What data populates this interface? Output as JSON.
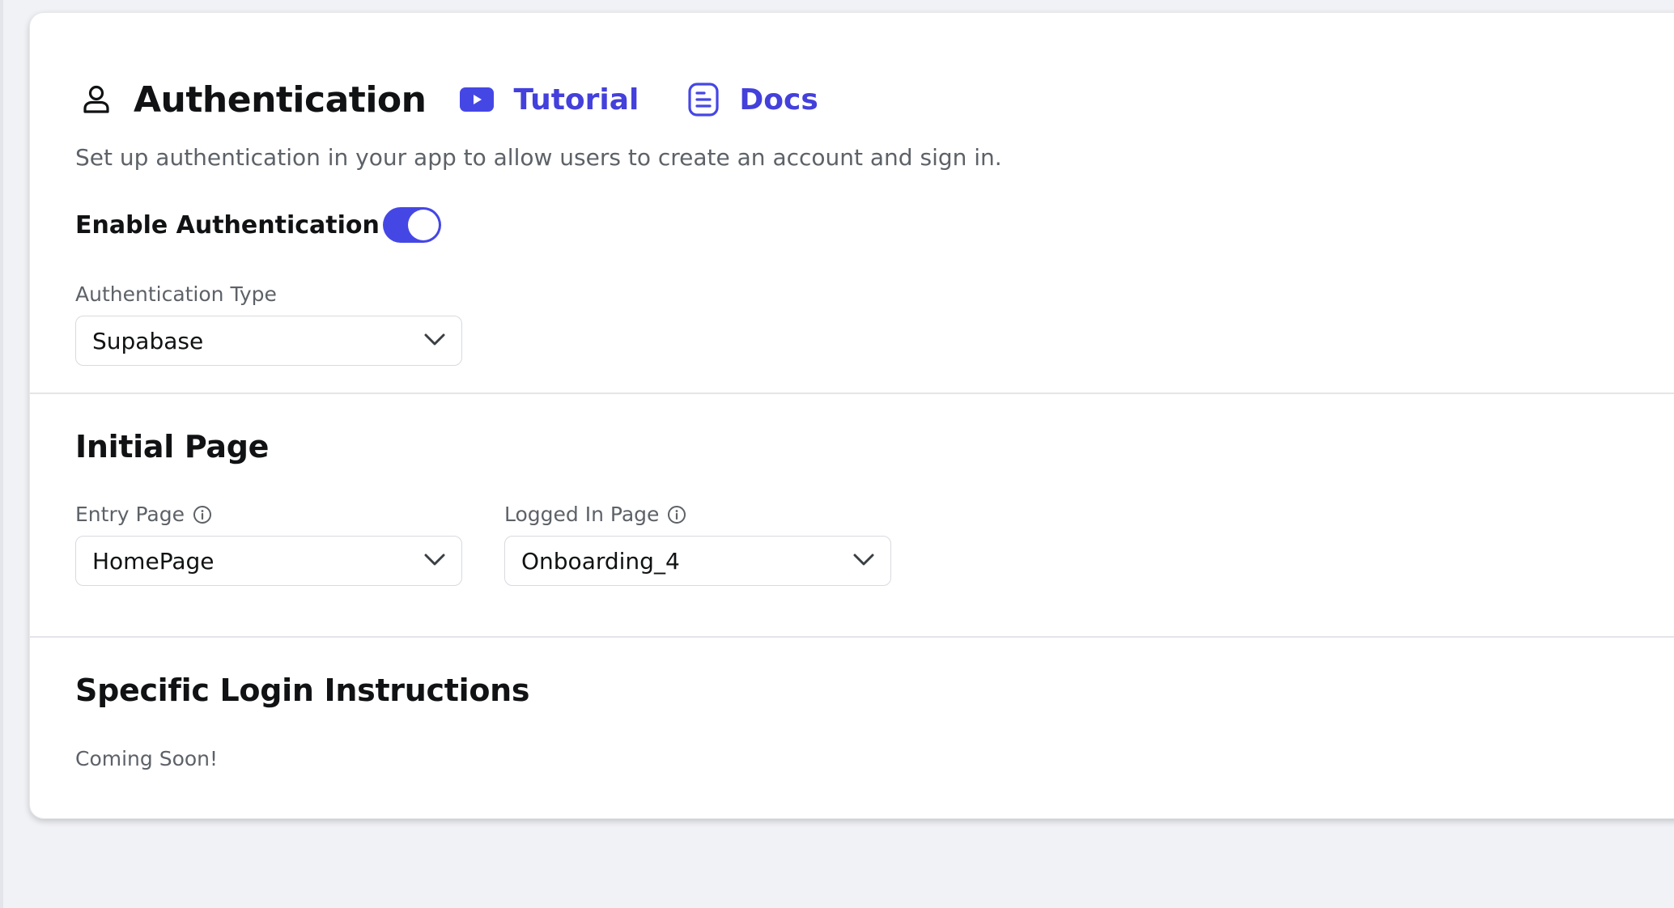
{
  "header": {
    "title": "Authentication",
    "tutorial_label": "Tutorial",
    "docs_label": "Docs"
  },
  "subtitle": "Set up authentication in your app to allow users to create an account and sign in.",
  "enable_auth": {
    "label": "Enable Authentication",
    "enabled": true
  },
  "auth_type": {
    "label": "Authentication Type",
    "value": "Supabase"
  },
  "initial_page": {
    "title": "Initial Page",
    "entry_page": {
      "label": "Entry Page",
      "value": "HomePage"
    },
    "logged_in_page": {
      "label": "Logged In Page",
      "value": "Onboarding_4"
    }
  },
  "login_instructions": {
    "title": "Specific Login Instructions",
    "text": "Coming Soon!"
  },
  "colors": {
    "accent": "#4340db",
    "toggle_on": "#4547e5",
    "youtube_icon": "#4547e5"
  },
  "icons": {
    "header": "person-icon",
    "tutorial": "youtube-play-icon",
    "docs": "document-icon",
    "dropdown": "chevron-down-icon",
    "info": "info-icon"
  }
}
